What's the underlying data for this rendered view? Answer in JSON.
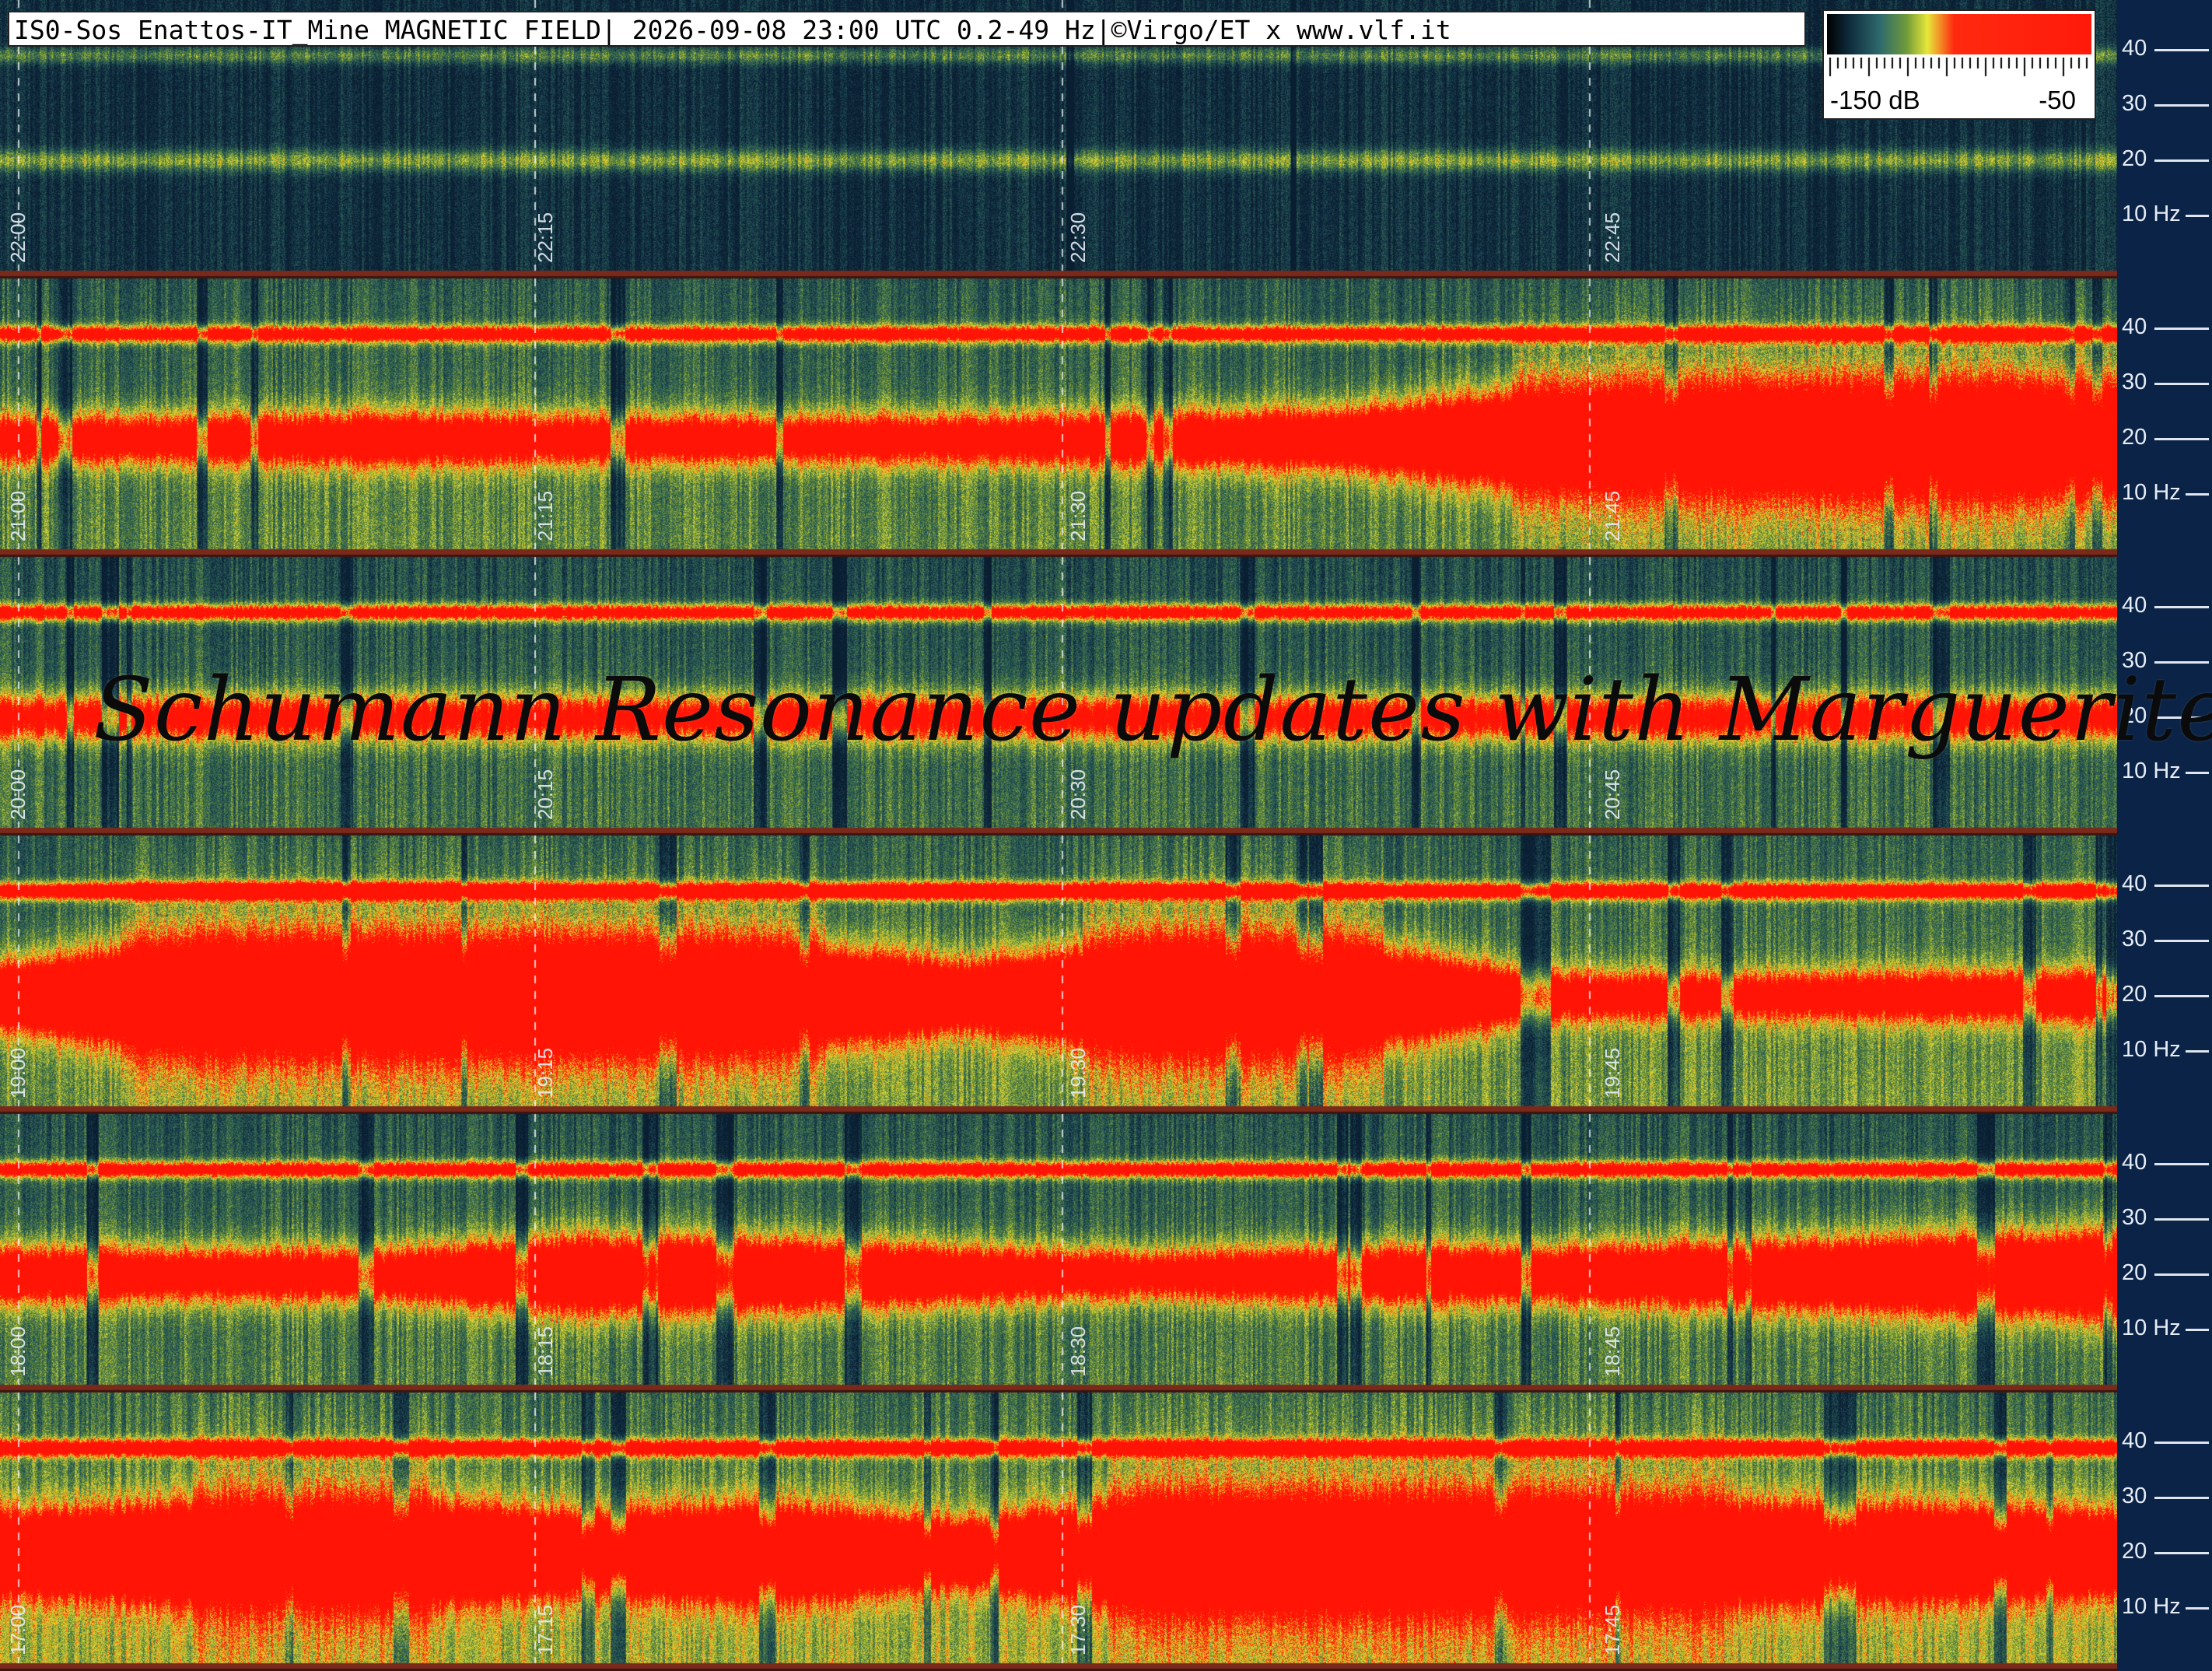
{
  "header": {
    "title": "IS0-Sos Enattos-IT_Mine MAGNETIC FIELD| 2026-09-08 23:00 UTC 0.2-49 Hz|©Virgo/ET x www.vlf.it"
  },
  "scale": {
    "min_label": "-150 dB",
    "max_label": "-50",
    "colors": [
      "#000000",
      "#0d2a3a",
      "#2e6a6e",
      "#6f9a3a",
      "#e8e83a",
      "#ff2a10",
      "#ff1a0a"
    ]
  },
  "watermark": "Schumann Resonance updates with Marguerite",
  "chart_data": {
    "type": "heatmap",
    "title": "IS0-Sos Enattos-IT_Mine MAGNETIC FIELD",
    "xlabel": "",
    "ylabel": "",
    "frequency_range_hz": [
      0.2,
      49
    ],
    "y_tick_labels": [
      "40",
      "30",
      "20",
      "10 Hz"
    ],
    "y_ticks_hz": [
      40,
      30,
      20,
      10
    ],
    "color_scale_db": [
      -150,
      -50
    ],
    "schumann_bands_hz": [
      20,
      39
    ],
    "rows": [
      {
        "start": "22:00",
        "time_labels": [
          "22:00",
          "22:15",
          "22:30",
          "22:45"
        ],
        "lower_band_intensity": [
          0.05,
          0.05,
          0.05,
          0.05,
          0.05,
          0.05,
          0.05,
          0.05,
          0.05,
          0.05,
          0.05,
          0.05
        ],
        "upper_band_intensity": [
          0.05,
          0.05,
          0.05,
          0.05,
          0.05,
          0.05,
          0.05,
          0.05,
          0.05,
          0.05,
          0.05,
          0.05
        ],
        "noise": 0.1
      },
      {
        "start": "21:00",
        "time_labels": [
          "21:00",
          "21:15",
          "21:30",
          "21:45"
        ],
        "lower_band_intensity": [
          0.4,
          0.4,
          0.45,
          0.4,
          0.4,
          0.4,
          0.45,
          0.55,
          0.9,
          0.95,
          1.0,
          0.95
        ],
        "upper_band_intensity": [
          0.55,
          0.55,
          0.55,
          0.55,
          0.55,
          0.55,
          0.55,
          0.55,
          0.55,
          0.55,
          0.55,
          0.55
        ],
        "noise": 0.55
      },
      {
        "start": "20:00",
        "time_labels": [
          "20:00",
          "20:15",
          "20:30",
          "20:45"
        ],
        "lower_band_intensity": [
          0.35,
          0.35,
          0.35,
          0.35,
          0.35,
          0.35,
          0.35,
          0.35,
          0.35,
          0.35,
          0.35,
          0.35
        ],
        "upper_band_intensity": [
          0.55,
          0.55,
          0.55,
          0.55,
          0.55,
          0.55,
          0.55,
          0.55,
          0.55,
          0.55,
          0.55,
          0.55
        ],
        "noise": 0.45
      },
      {
        "start": "19:00",
        "time_labels": [
          "19:00",
          "19:15",
          "19:30",
          "19:45"
        ],
        "lower_band_intensity": [
          0.6,
          1.0,
          1.0,
          1.0,
          0.95,
          0.6,
          1.0,
          0.95,
          0.4,
          0.35,
          0.4,
          0.4
        ],
        "upper_band_intensity": [
          0.6,
          0.8,
          0.85,
          0.6,
          0.6,
          0.8,
          0.6,
          0.6,
          0.6,
          0.6,
          0.6,
          0.6
        ],
        "noise": 0.6
      },
      {
        "start": "18:00",
        "time_labels": [
          "18:00",
          "18:15",
          "18:30",
          "18:45"
        ],
        "lower_band_intensity": [
          0.5,
          0.45,
          0.45,
          0.7,
          0.65,
          0.5,
          0.4,
          0.5,
          0.5,
          0.6,
          0.7,
          0.8
        ],
        "upper_band_intensity": [
          0.55,
          0.55,
          0.55,
          0.55,
          0.55,
          0.55,
          0.55,
          0.55,
          0.55,
          0.55,
          0.55,
          0.55
        ],
        "noise": 0.5
      },
      {
        "start": "17:00",
        "time_labels": [
          "17:00",
          "17:15",
          "17:30",
          "17:45"
        ],
        "lower_band_intensity": [
          0.7,
          0.85,
          0.9,
          0.7,
          0.85,
          0.55,
          0.95,
          0.95,
          0.95,
          0.85,
          0.8,
          0.7
        ],
        "upper_band_intensity": [
          0.55,
          0.55,
          0.55,
          0.55,
          0.55,
          0.55,
          0.55,
          0.55,
          0.55,
          0.55,
          0.55,
          0.55
        ],
        "noise": 0.7
      }
    ]
  }
}
